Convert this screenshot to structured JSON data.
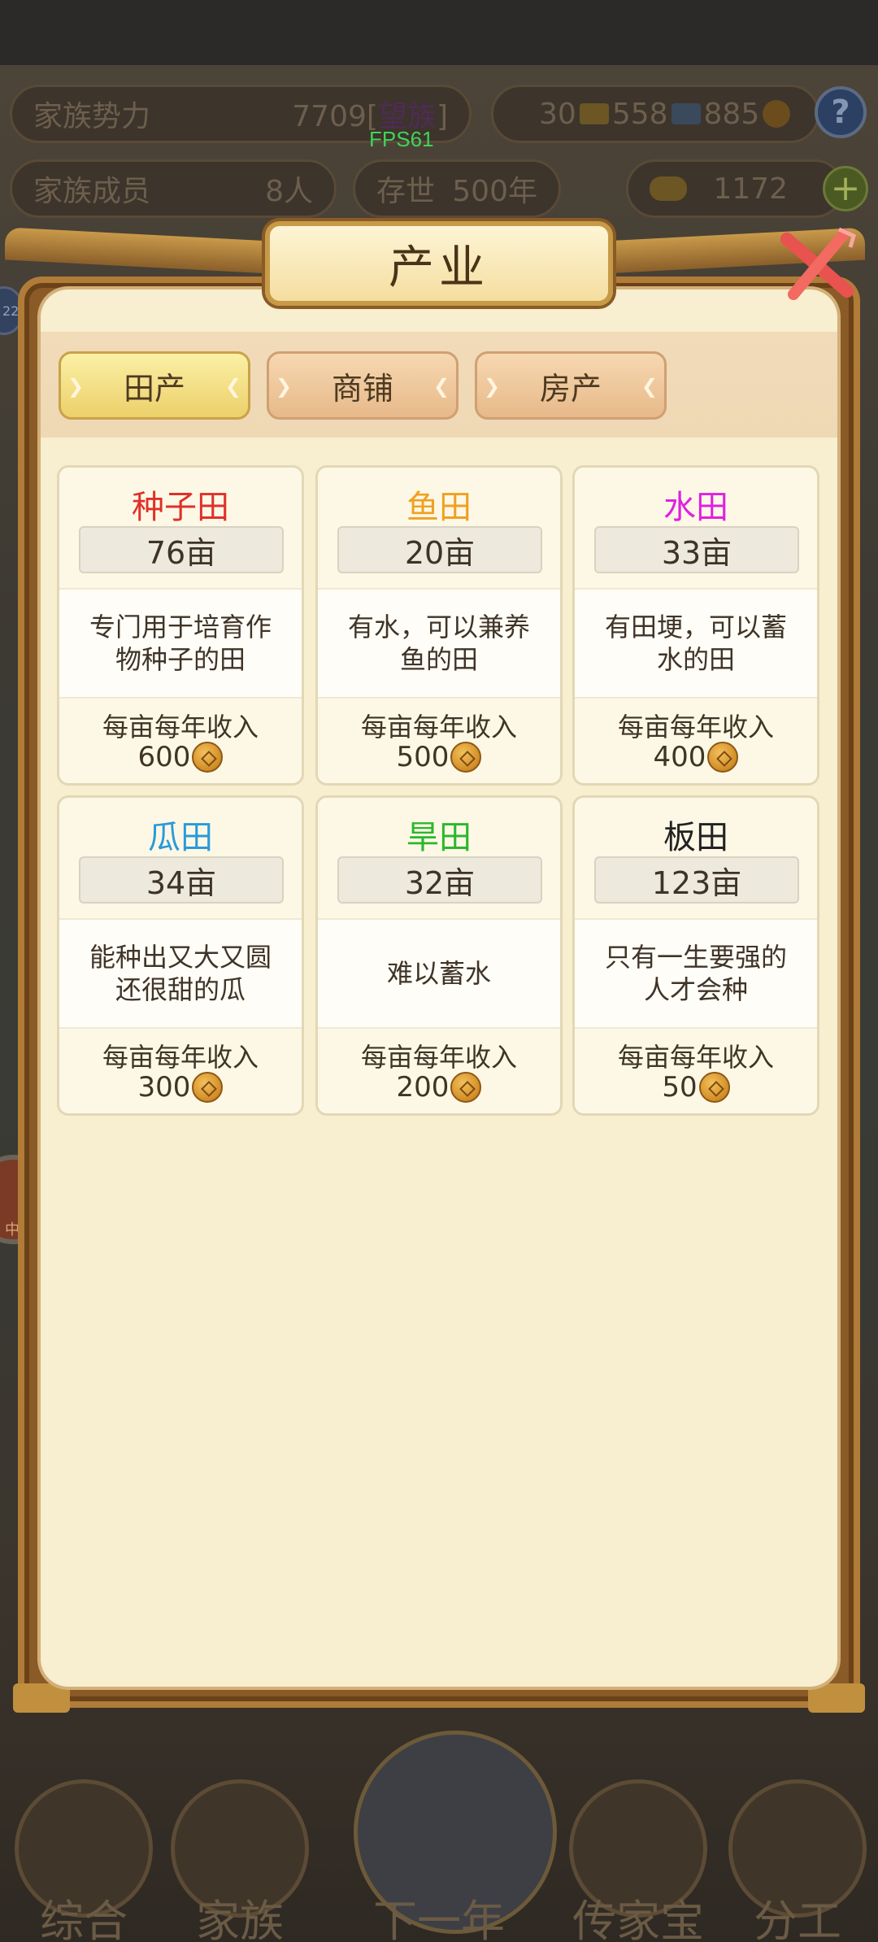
{
  "hud": {
    "family_power_label": "家族势力",
    "family_power_value": "7709[",
    "family_power_rank": "望族",
    "family_power_close": "]",
    "fps": "FPS61",
    "res_gold": "30",
    "res_silver": "558",
    "res_coin": "885",
    "family_members_label": "家族成员",
    "family_members_value": "8人",
    "years_label": "存世",
    "years_value": "500年",
    "ingots": "1172",
    "help": "?",
    "side_badge_text": "中国",
    "side_small_text": "22"
  },
  "bottom_nav": [
    {
      "label": "综合"
    },
    {
      "label": "家族"
    },
    {
      "label": "下一年"
    },
    {
      "label": "传家宝"
    },
    {
      "label": "分工"
    }
  ],
  "modal": {
    "title": "产业",
    "tabs": [
      {
        "label": "田产",
        "active": true
      },
      {
        "label": "商铺",
        "active": false
      },
      {
        "label": "房产",
        "active": false
      }
    ],
    "fields": [
      {
        "name": "种子田",
        "color": "#e0302a",
        "area": "76亩",
        "desc": "专门用于培育作物种子的田",
        "income_label": "每亩每年收入",
        "income": "600"
      },
      {
        "name": "鱼田",
        "color": "#f0a020",
        "area": "20亩",
        "desc": "有水，可以兼养鱼的田",
        "income_label": "每亩每年收入",
        "income": "500"
      },
      {
        "name": "水田",
        "color": "#e020e0",
        "area": "33亩",
        "desc": "有田埂，可以蓄水的田",
        "income_label": "每亩每年收入",
        "income": "400"
      },
      {
        "name": "瓜田",
        "color": "#2a9ad8",
        "area": "34亩",
        "desc": "能种出又大又圆还很甜的瓜",
        "income_label": "每亩每年收入",
        "income": "300"
      },
      {
        "name": "旱田",
        "color": "#2ab82a",
        "area": "32亩",
        "desc": "难以蓄水",
        "income_label": "每亩每年收入",
        "income": "200"
      },
      {
        "name": "板田",
        "color": "#222222",
        "area": "123亩",
        "desc": "只有一生要强的人才会种",
        "income_label": "每亩每年收入",
        "income": "50"
      }
    ]
  }
}
